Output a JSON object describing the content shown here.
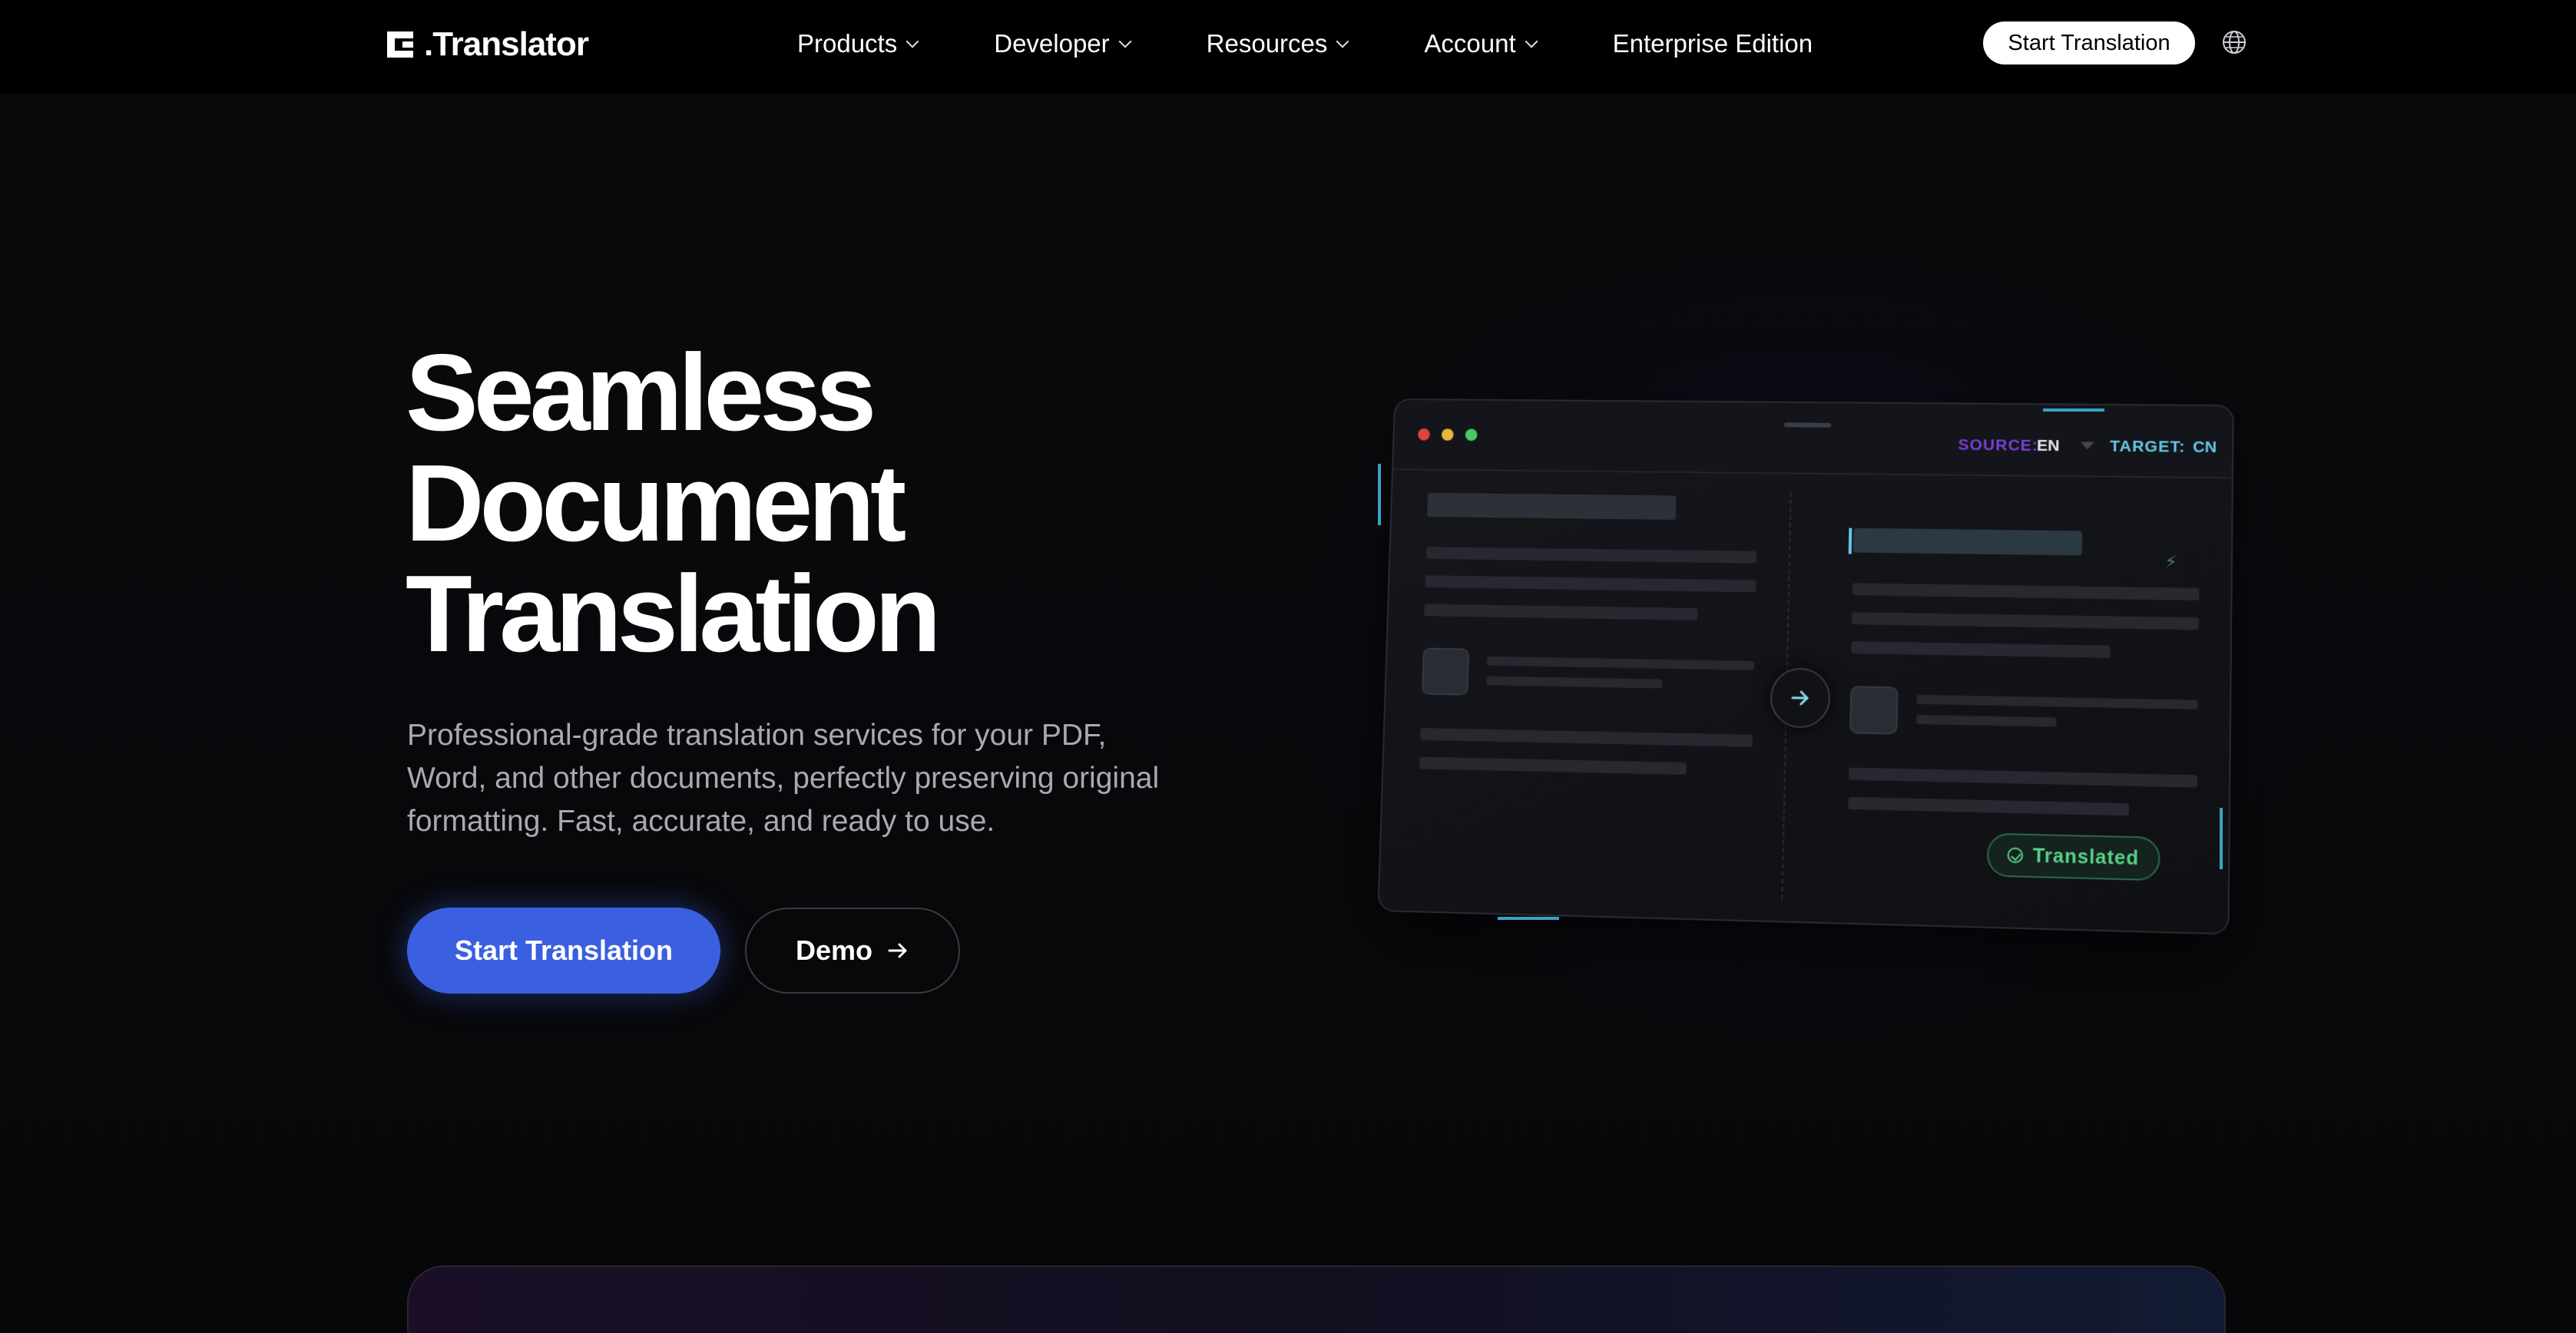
{
  "nav": {
    "logo_text": ".Translator",
    "items": [
      {
        "label": "Products"
      },
      {
        "label": "Developer"
      },
      {
        "label": "Resources"
      },
      {
        "label": "Account"
      },
      {
        "label": "Enterprise Edition"
      }
    ],
    "cta_label": "Start Translation"
  },
  "hero": {
    "title_lines": [
      "Seamless",
      "Document",
      "Translation"
    ],
    "subtitle": "Professional-grade translation services for your PDF, Word, and other documents, perfectly preserving original formatting. Fast, accurate, and ready to use.",
    "primary_button": "Start Translation",
    "secondary_button": "Demo"
  },
  "mock": {
    "source_label": "SOURCE:",
    "source_value": "EN",
    "target_label": "TARGET:",
    "target_value": "CN",
    "status_badge": "Translated"
  },
  "colors": {
    "primary_button": "#3a5fe0",
    "source_accent": "#7a3fd8",
    "target_accent": "#67c8e8",
    "success": "#58d28a",
    "traffic_red": "#e0443f",
    "traffic_yellow": "#e8b73c",
    "traffic_green": "#4cc96a"
  },
  "icons": {
    "chevron": "chevron-down-icon",
    "globe": "globe-icon",
    "arrow": "arrow-right-icon",
    "bolt": "lightning-icon",
    "check": "check-circle-icon"
  }
}
